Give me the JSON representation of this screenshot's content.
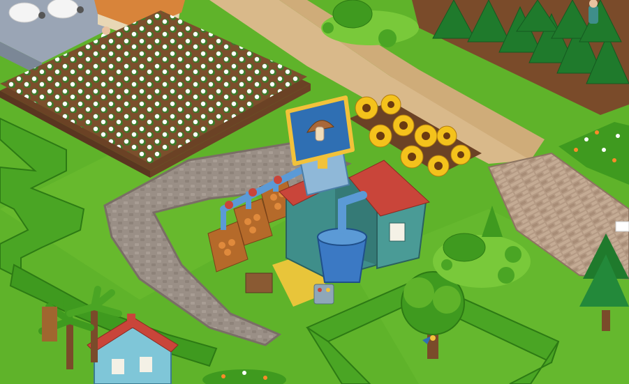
{
  "scene": {
    "type": "isometric-farm-game-view",
    "objects": [
      {
        "key": "mushroom-factory",
        "sign_icon": "mushroom-icon"
      },
      {
        "key": "cotton-field"
      },
      {
        "key": "sunflower-bed"
      },
      {
        "key": "pine-forest"
      },
      {
        "key": "sheep-pen"
      },
      {
        "key": "farmhouse"
      },
      {
        "key": "cottage"
      },
      {
        "key": "topiary-garden-top"
      },
      {
        "key": "topiary-garden-right"
      },
      {
        "key": "hedge-enclosure"
      },
      {
        "key": "oak-tree"
      },
      {
        "key": "stone-path"
      },
      {
        "key": "dirt-road"
      }
    ]
  },
  "colors": {
    "grass": "#5fb32a",
    "grass_light": "#79c93a",
    "hedge": "#3f9a1f",
    "hedge_light": "#6cc53b",
    "path": "#9a8f86",
    "path_edge": "#7a6e66",
    "road": "#d9b98a",
    "soil": "#8a5a33",
    "soil_dark": "#6b4225",
    "roof_red": "#c9453a",
    "wall_teal": "#3f8e8a",
    "sign_blue": "#2f6fb3",
    "sign_frame": "#f2c23a",
    "pipe": "#5b9ad6",
    "pine": "#1f7a2c",
    "sunflower": "#f4c21c"
  }
}
